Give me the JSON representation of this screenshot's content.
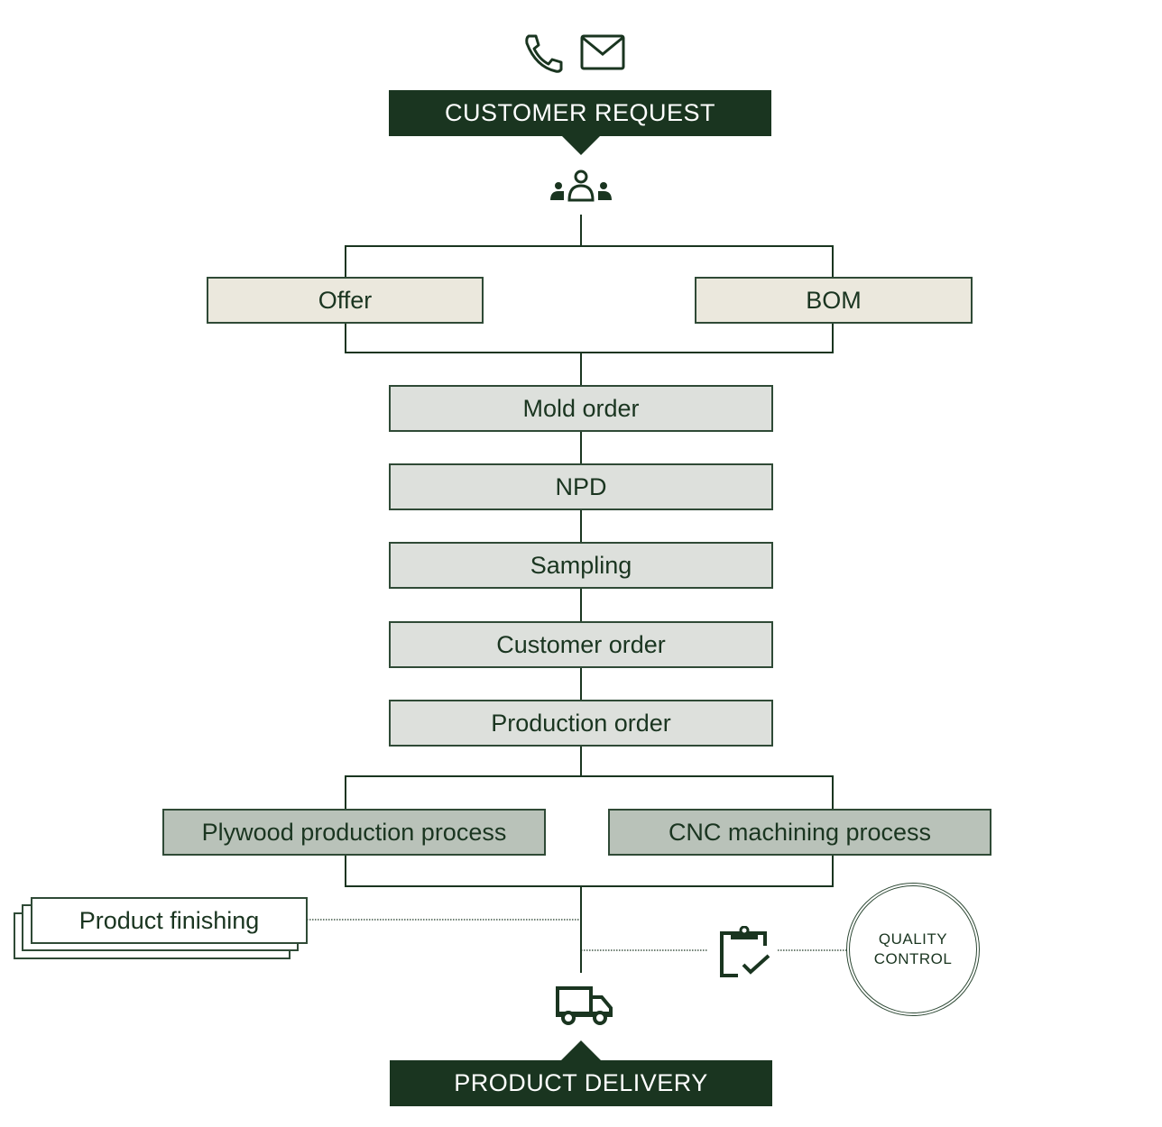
{
  "diagram": {
    "start_banner": "CUSTOMER REQUEST",
    "end_banner": "PRODUCT DELIVERY",
    "icons": {
      "top": [
        "phone-icon",
        "mail-icon"
      ],
      "team": "team-icon",
      "quality": "clipboard-check-icon",
      "delivery": "truck-icon"
    },
    "branch_1": {
      "left": "Offer",
      "right": "BOM"
    },
    "sequence": [
      "Mold order",
      "NPD",
      "Sampling",
      "Customer order",
      "Production order"
    ],
    "branch_2": {
      "left": "Plywood production process",
      "right": "CNC machining process"
    },
    "side_left": "Product finishing",
    "side_right": {
      "line1": "QUALITY",
      "line2": "CONTROL"
    },
    "colors": {
      "dark_green": "#1a3520",
      "beige": "#ebe8dd",
      "light_gray": "#dde0dc",
      "mid_gray": "#b9c2b9"
    }
  }
}
